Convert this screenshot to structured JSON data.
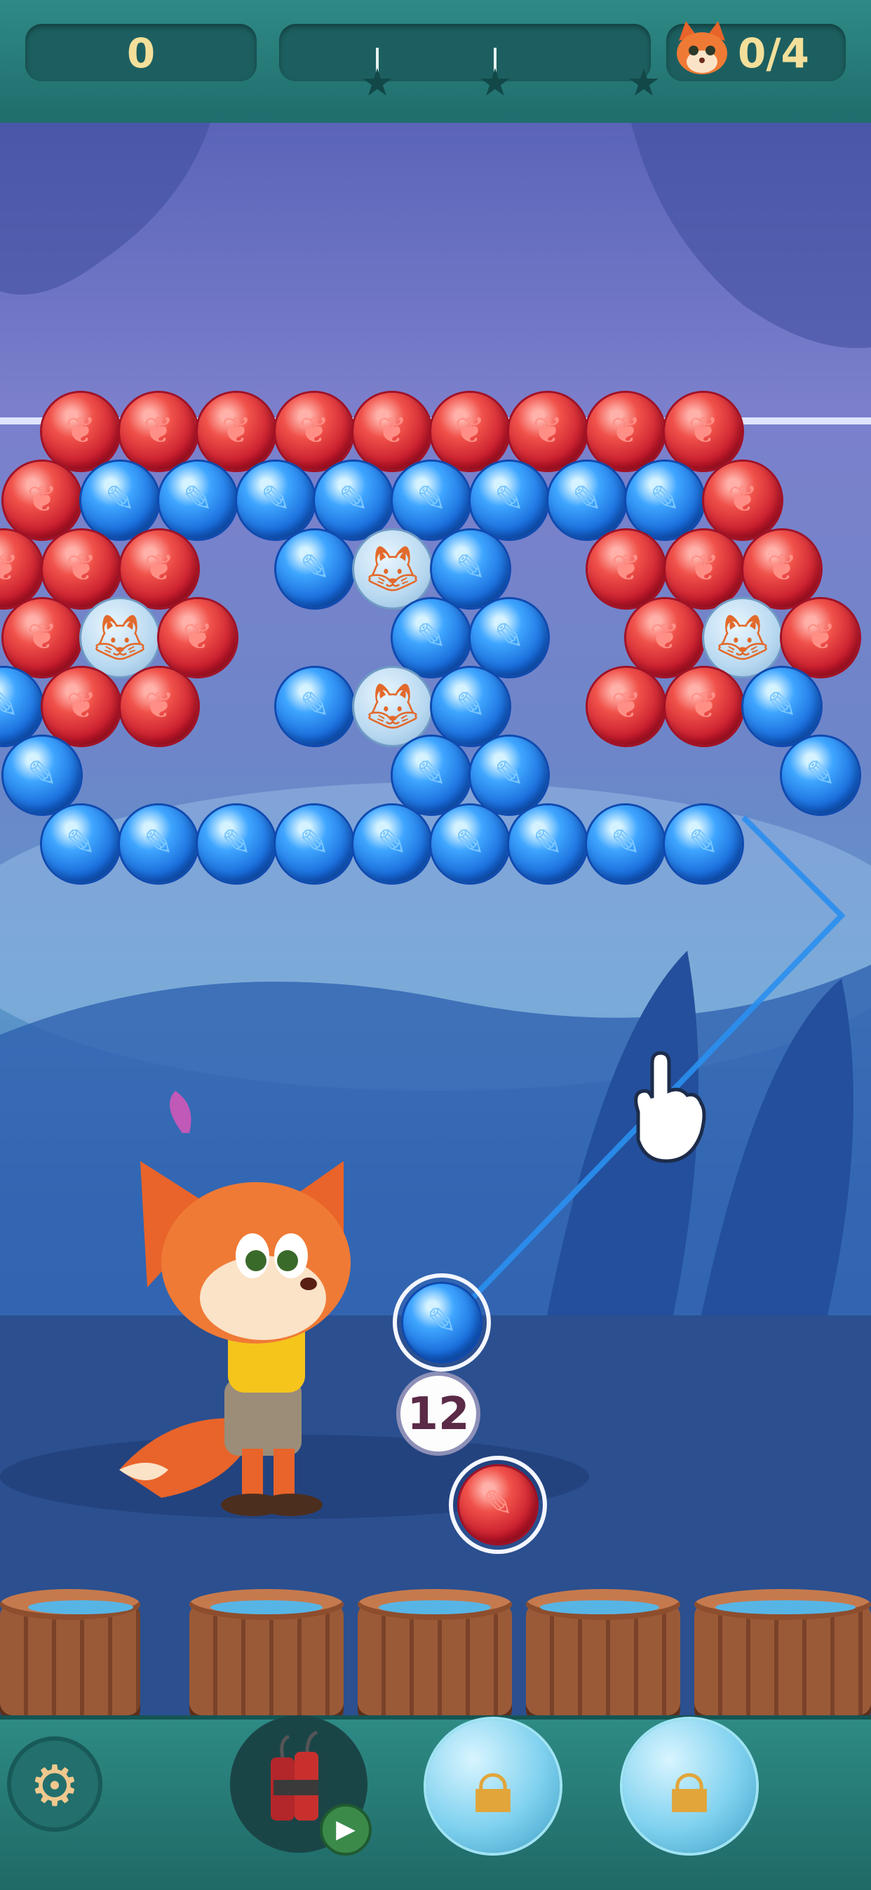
{
  "hud": {
    "score": "0",
    "goal": "0/4",
    "icons": {
      "star": "star-icon",
      "goal": "fox-face-icon"
    }
  },
  "board": {
    "colors": {
      "red": "#d9202e",
      "blue": "#1e7be8"
    },
    "rows": [
      [
        "red",
        "red",
        "red",
        "red",
        "red",
        "red",
        "red",
        "red",
        "red"
      ],
      [
        "red",
        "blue",
        "blue",
        "blue",
        "blue",
        "blue",
        "blue",
        "blue",
        "blue",
        "red"
      ],
      [
        "red",
        "red",
        "red",
        "",
        "blue",
        "fox",
        "blue",
        "",
        "red",
        "red",
        "red"
      ],
      [
        "red",
        "fox",
        "red",
        "",
        "",
        "blue",
        "blue",
        "",
        "red",
        "fox",
        "red"
      ],
      [
        "blue",
        "red",
        "red",
        "",
        "blue",
        "fox",
        "blue",
        "",
        "red",
        "red",
        "blue"
      ],
      [
        "blue",
        "",
        "",
        "",
        "",
        "blue",
        "blue",
        "",
        "",
        "",
        "blue"
      ],
      [
        "blue",
        "blue",
        "blue",
        "blue",
        "blue",
        "blue",
        "blue",
        "blue",
        "blue"
      ]
    ]
  },
  "shooter": {
    "current_bubble": "blue",
    "next_bubble": "red",
    "shots_left": "12"
  },
  "toolbar": {
    "settings_icon": "gear-icon",
    "booster_icon": "dynamite-icon",
    "video_icon": "video-icon",
    "lock_icon": "lock-icon"
  }
}
